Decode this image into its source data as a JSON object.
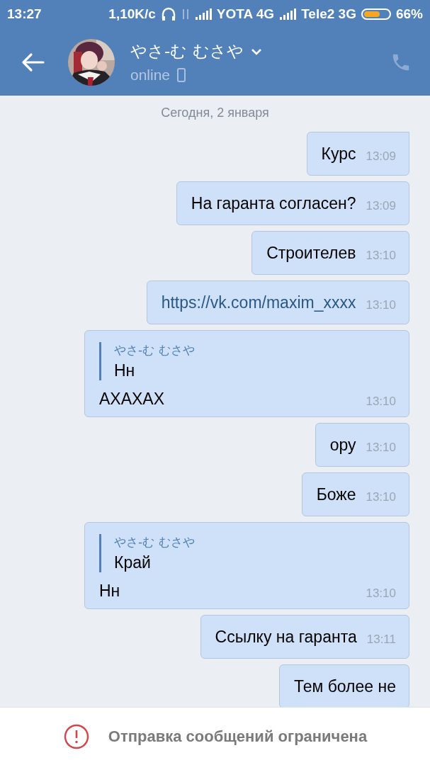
{
  "status_bar": {
    "time": "13:27",
    "speed": "1,10K/c",
    "sim1": "YOTA 4G",
    "sim2": "Tele2 3G",
    "battery": {
      "level": 0.66,
      "text": "66%"
    }
  },
  "header": {
    "name": "やさ-む むさや",
    "status": "online"
  },
  "date": "Сегодня, 2 января",
  "messages": [
    {
      "kind": "text",
      "text": "Курс",
      "time": "13:09",
      "tail": true
    },
    {
      "kind": "text",
      "text": "На гаранта согласен?",
      "time": "13:09",
      "tail": false
    },
    {
      "kind": "text",
      "text": "Строителев",
      "time": "13:10",
      "tail": false
    },
    {
      "kind": "link",
      "text": "https://vk.com/maxim_xxxx",
      "time": "13:10",
      "tail": false
    },
    {
      "kind": "reply",
      "reply": {
        "author": "やさ-む むさや",
        "text": "Нн"
      },
      "text": "АХАХАХ",
      "time": "13:10",
      "tail": false
    },
    {
      "kind": "text",
      "text": "ору",
      "time": "13:10",
      "tail": false
    },
    {
      "kind": "text",
      "text": "Боже",
      "time": "13:10",
      "tail": false
    },
    {
      "kind": "reply",
      "reply": {
        "author": "やさ-む むさや",
        "text": "Край"
      },
      "text": "Нн",
      "time": "13:10",
      "tail": false
    },
    {
      "kind": "text",
      "text": "Ссылку на гаранта",
      "time": "13:11",
      "tail": false
    },
    {
      "kind": "text",
      "text": "Тем более не",
      "tail": false
    }
  ],
  "notice": "Отправка сообщений ограничена"
}
